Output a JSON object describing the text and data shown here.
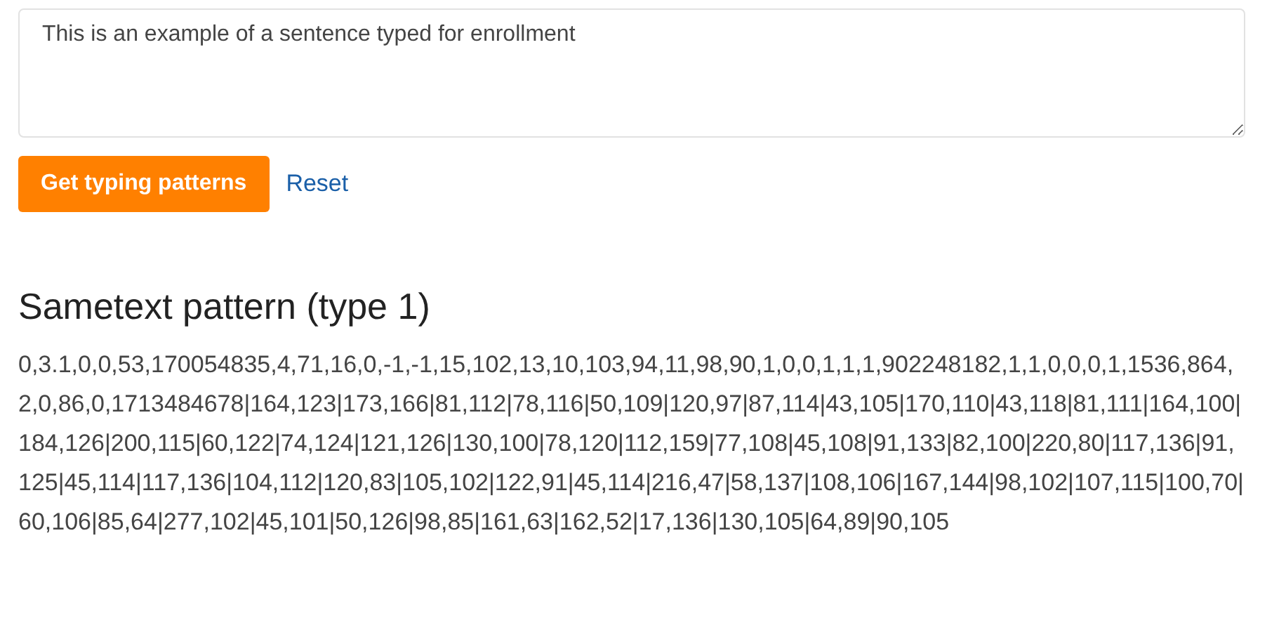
{
  "input": {
    "value": "This is an example of a sentence typed for enrollment"
  },
  "buttons": {
    "primary": "Get typing patterns",
    "link": "Reset"
  },
  "result": {
    "title": "Sametext pattern (type 1)",
    "pattern": "0,3.1,0,0,53,170054835,4,71,16,0,-1,-1,15,102,13,10,103,94,11,98,90,1,0,0,1,1,1,902248182,1,1,0,0,0,1,1536,864,2,0,86,0,1713484678|164,123|173,166|81,112|78,116|50,109|120,97|87,114|43,105|170,110|43,118|81,111|164,100|184,126|200,115|60,122|74,124|121,126|130,100|78,120|112,159|77,108|45,108|91,133|82,100|220,80|117,136|91,125|45,114|117,136|104,112|120,83|105,102|122,91|45,114|216,47|58,137|108,106|167,144|98,102|107,115|100,70|60,106|85,64|277,102|45,101|50,126|98,85|161,63|162,52|17,136|130,105|64,89|90,105"
  }
}
